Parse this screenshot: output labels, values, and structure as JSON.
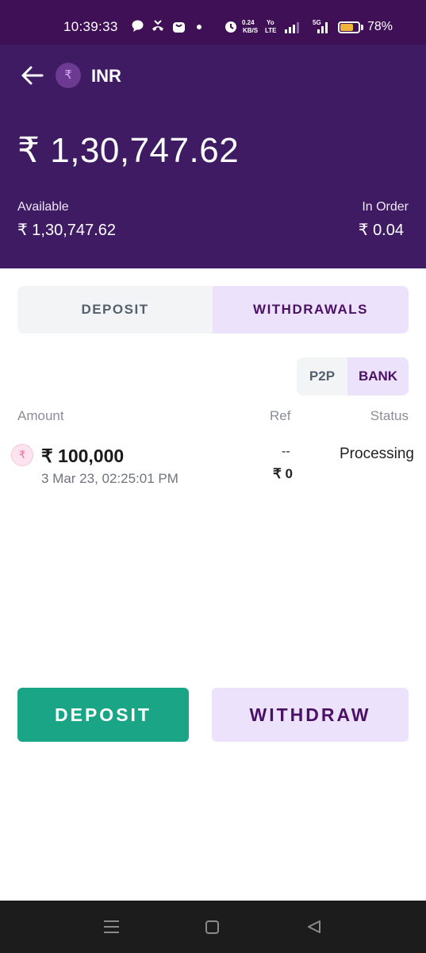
{
  "status_bar": {
    "time": "10:39:33",
    "net_speed_value": "0.24",
    "net_speed_unit": "KB/S",
    "volte_top": "Yo",
    "volte_bottom": "LTE",
    "network": "5G",
    "battery_percent": "78%",
    "battery_level": 0.78,
    "battery_color": "#f0b43a"
  },
  "header": {
    "currency_symbol": "₹",
    "currency": "INR",
    "total_balance": "₹ 1,30,747.62",
    "available_label": "Available",
    "available_value": "₹ 1,30,747.62",
    "in_order_label": "In Order",
    "in_order_value": "₹ 0.04",
    "bg_color": "#3f1b63"
  },
  "tabs": {
    "deposit": "DEPOSIT",
    "withdrawals": "WITHDRAWALS",
    "active": "withdrawals"
  },
  "method_toggle": {
    "p2p": "P2P",
    "bank": "BANK",
    "active": "bank"
  },
  "table": {
    "columns": {
      "amount": "Amount",
      "ref": "Ref",
      "status": "Status"
    },
    "rows": [
      {
        "coin_symbol": "₹",
        "amount": "₹ 100,000",
        "datetime": "3 Mar 23, 02:25:01 PM",
        "ref_top": "--",
        "ref_bottom": "₹ 0",
        "status": "Processing"
      }
    ]
  },
  "actions": {
    "deposit": "DEPOSIT",
    "withdraw": "WITHDRAW",
    "deposit_color": "#1aa587",
    "withdraw_color": "#ede2fb"
  }
}
